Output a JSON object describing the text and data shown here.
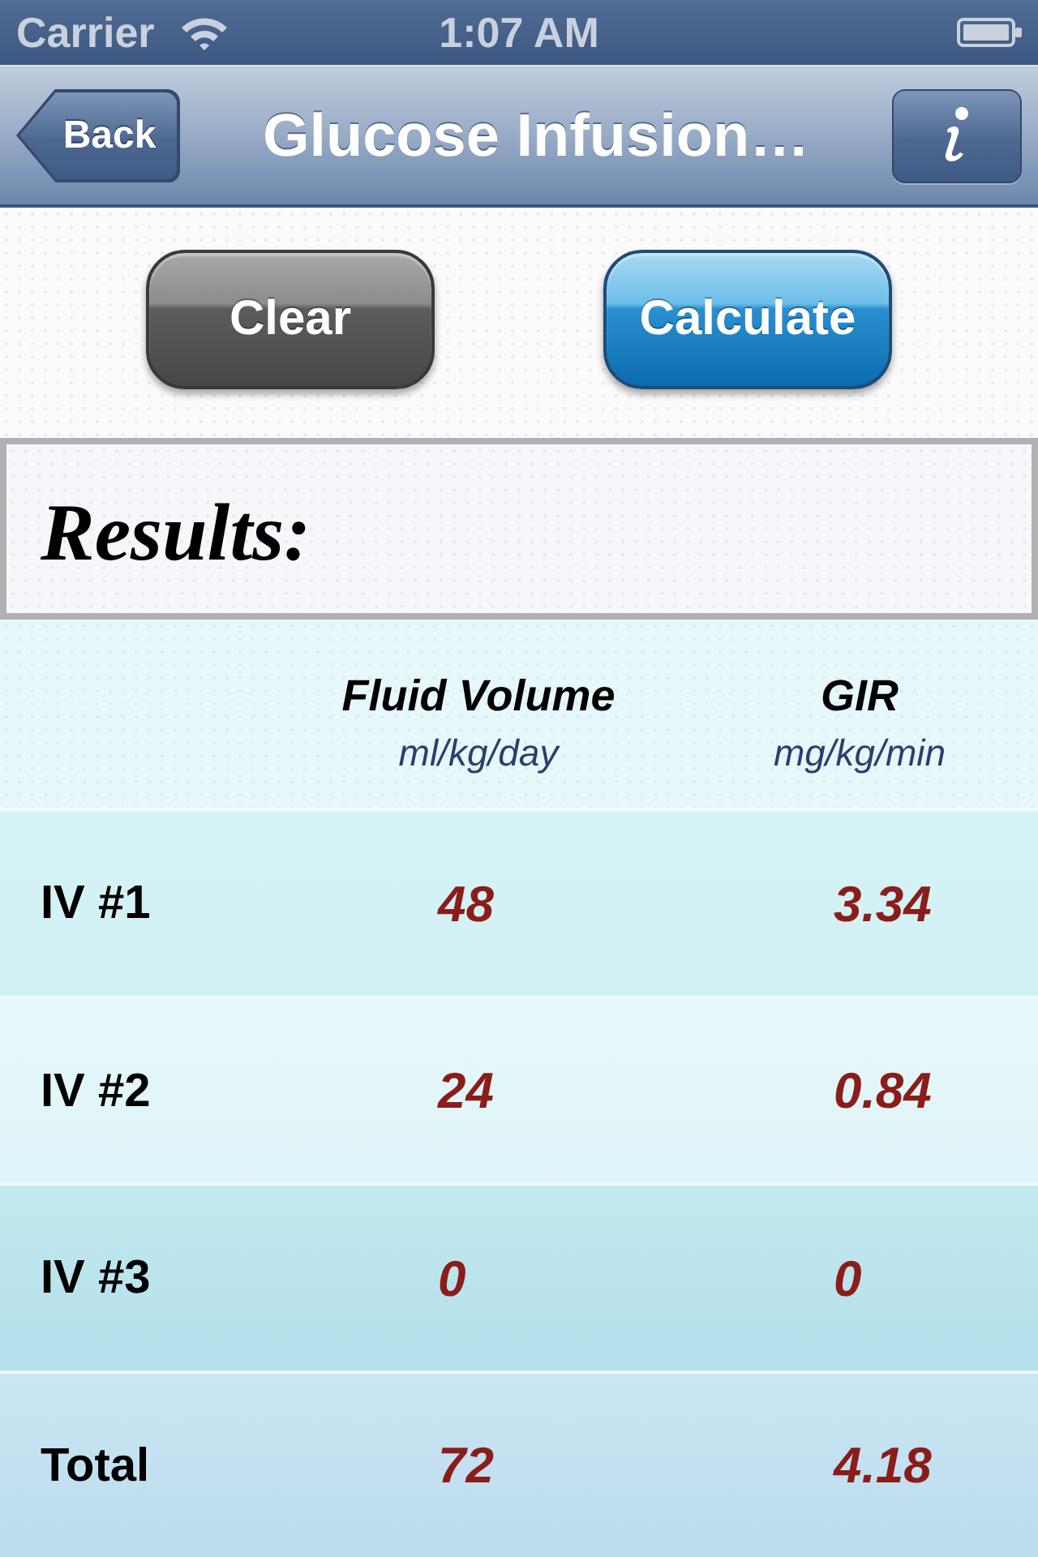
{
  "status_bar": {
    "carrier": "Carrier",
    "time": "1:07 AM"
  },
  "nav_bar": {
    "back": "Back",
    "title": "Glucose Infusion…"
  },
  "buttons": [
    {
      "label": "Clear",
      "kind": "secondary"
    },
    {
      "label": "Calculate",
      "kind": "primary"
    }
  ],
  "results": {
    "title": "Results:"
  },
  "table": {
    "columns": [
      {
        "title": "Fluid Volume",
        "unit": "ml/kg/day"
      },
      {
        "title": "GIR",
        "unit": "mg/kg/min"
      }
    ],
    "rows": [
      {
        "label": "IV #1",
        "values": [
          "48",
          "3.34"
        ]
      },
      {
        "label": "IV #2",
        "values": [
          "24",
          "0.84"
        ]
      },
      {
        "label": "IV #3",
        "values": [
          "0",
          "0"
        ]
      },
      {
        "label": "Total",
        "values": [
          "72",
          "4.18"
        ]
      }
    ]
  }
}
